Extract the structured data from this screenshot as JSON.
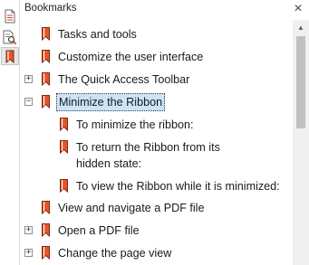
{
  "panel": {
    "title": "Bookmarks",
    "close_glyph": "×"
  },
  "toolstrip": [
    {
      "name": "page-thumbnails-icon"
    },
    {
      "name": "search-document-icon"
    },
    {
      "name": "bookmark-panel-icon"
    }
  ],
  "tree": {
    "expander_plus": "+",
    "expander_minus": "−",
    "items": [
      {
        "label": "Tasks and tools",
        "level": 0,
        "expander": "none"
      },
      {
        "label": "Customize the user interface",
        "level": 0,
        "expander": "none"
      },
      {
        "label": "The Quick Access Toolbar",
        "level": 0,
        "expander": "plus"
      },
      {
        "label": "Minimize the Ribbon",
        "level": 0,
        "expander": "minus",
        "selected": true
      },
      {
        "label": "To minimize the ribbon:",
        "level": 1,
        "expander": "none"
      },
      {
        "label": "To return the Ribbon from its hidden state:",
        "level": 1,
        "expander": "none"
      },
      {
        "label": "To view the Ribbon while it is minimized:",
        "level": 1,
        "expander": "none"
      },
      {
        "label": "View and navigate a PDF file",
        "level": 0,
        "expander": "none"
      },
      {
        "label": "Open a PDF file",
        "level": 0,
        "expander": "plus"
      },
      {
        "label": "Change the page view",
        "level": 0,
        "expander": "plus"
      }
    ]
  },
  "colors": {
    "bookmark_red": "#d04a1c",
    "selection_bg": "#cce4f7"
  }
}
